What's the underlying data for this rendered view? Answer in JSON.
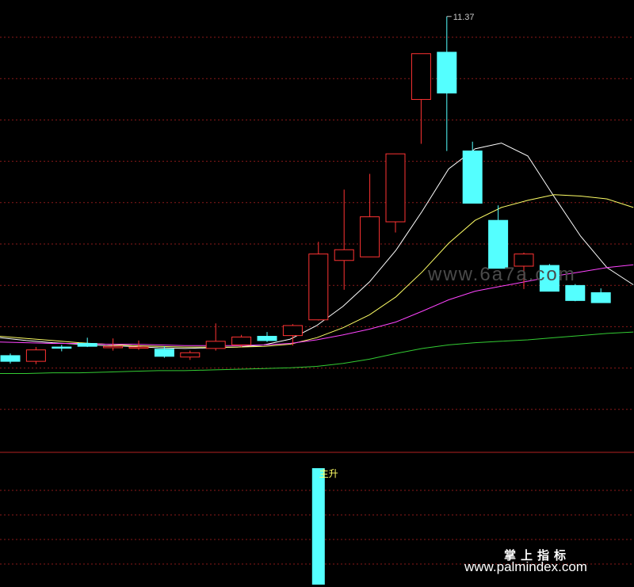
{
  "colors": {
    "background": "#000000",
    "grid": "#8b1a1a",
    "divider": "#b22222",
    "up": "#ff3333",
    "down": "#54ffff",
    "ma_white": "#ffffff",
    "ma_yellow": "#ffff66",
    "ma_magenta": "#ff44ff",
    "ma_green": "#33cc33",
    "label": "#c8c8c8",
    "signal": "#54ffff"
  },
  "chart_data": [
    {
      "type": "candlestick",
      "price_label": "11.37",
      "ylim": [
        5.4,
        11.6
      ],
      "candles": [
        {
          "o": 6.63,
          "h": 6.66,
          "l": 6.52,
          "c": 6.55
        },
        {
          "o": 6.55,
          "h": 6.75,
          "l": 6.51,
          "c": 6.71
        },
        {
          "o": 6.75,
          "h": 6.78,
          "l": 6.69,
          "c": 6.74
        },
        {
          "o": 6.8,
          "h": 6.88,
          "l": 6.75,
          "c": 6.76
        },
        {
          "o": 6.74,
          "h": 6.87,
          "l": 6.7,
          "c": 6.76
        },
        {
          "o": 6.75,
          "h": 6.84,
          "l": 6.71,
          "c": 6.75
        },
        {
          "o": 6.72,
          "h": 6.76,
          "l": 6.6,
          "c": 6.62
        },
        {
          "o": 6.61,
          "h": 6.7,
          "l": 6.57,
          "c": 6.67
        },
        {
          "o": 6.73,
          "h": 7.08,
          "l": 6.7,
          "c": 6.83
        },
        {
          "o": 6.78,
          "h": 6.92,
          "l": 6.75,
          "c": 6.89
        },
        {
          "o": 6.9,
          "h": 6.96,
          "l": 6.82,
          "c": 6.84
        },
        {
          "o": 6.91,
          "h": 7.07,
          "l": 6.77,
          "c": 7.05
        },
        {
          "o": 7.13,
          "h": 8.22,
          "l": 7.12,
          "c": 8.05
        },
        {
          "o": 7.96,
          "h": 8.95,
          "l": 7.55,
          "c": 8.11
        },
        {
          "o": 8.01,
          "h": 9.17,
          "l": 8.01,
          "c": 8.57
        },
        {
          "o": 8.5,
          "h": 9.31,
          "l": 8.35,
          "c": 9.45
        },
        {
          "o": 10.21,
          "h": 10.21,
          "l": 9.59,
          "c": 10.85
        },
        {
          "o": 10.87,
          "h": 11.37,
          "l": 9.49,
          "c": 10.3
        },
        {
          "o": 9.49,
          "h": 9.62,
          "l": 8.76,
          "c": 8.76
        },
        {
          "o": 8.52,
          "h": 8.73,
          "l": 7.85,
          "c": 7.85
        },
        {
          "o": 7.88,
          "h": 8.07,
          "l": 7.56,
          "c": 8.05
        },
        {
          "o": 7.89,
          "h": 7.91,
          "l": 7.53,
          "c": 7.53
        },
        {
          "o": 7.61,
          "h": 7.63,
          "l": 7.39,
          "c": 7.4
        },
        {
          "o": 7.51,
          "h": 7.57,
          "l": 7.37,
          "c": 7.37
        }
      ],
      "ma_series": [
        {
          "color_key": "ma_white",
          "values": [
            6.88,
            6.84,
            6.81,
            6.79,
            6.77,
            6.76,
            6.74,
            6.73,
            6.74,
            6.75,
            6.78,
            6.86,
            7.05,
            7.32,
            7.66,
            8.1,
            8.65,
            9.24,
            9.52,
            9.6,
            9.42,
            8.85,
            8.3,
            7.86,
            7.62
          ]
        },
        {
          "color_key": "ma_yellow",
          "values": [
            6.9,
            6.87,
            6.84,
            6.81,
            6.79,
            6.77,
            6.76,
            6.75,
            6.75,
            6.75,
            6.76,
            6.79,
            6.88,
            7.02,
            7.2,
            7.45,
            7.8,
            8.2,
            8.52,
            8.7,
            8.8,
            8.88,
            8.86,
            8.82,
            8.7
          ]
        },
        {
          "color_key": "ma_magenta",
          "values": [
            6.82,
            6.81,
            6.8,
            6.8,
            6.79,
            6.79,
            6.78,
            6.77,
            6.77,
            6.77,
            6.78,
            6.8,
            6.85,
            6.92,
            7.0,
            7.1,
            7.25,
            7.41,
            7.53,
            7.6,
            7.67,
            7.74,
            7.8,
            7.86,
            7.9
          ]
        },
        {
          "color_key": "ma_green",
          "values": [
            6.38,
            6.38,
            6.39,
            6.39,
            6.4,
            6.41,
            6.42,
            6.42,
            6.43,
            6.44,
            6.45,
            6.46,
            6.48,
            6.52,
            6.58,
            6.66,
            6.73,
            6.78,
            6.81,
            6.83,
            6.85,
            6.88,
            6.91,
            6.94,
            6.96
          ]
        }
      ],
      "grid": true
    },
    {
      "type": "bar",
      "series_label": "主升",
      "ylim": [
        0,
        1
      ],
      "values": [
        0,
        0,
        0,
        0,
        0,
        0,
        0,
        0,
        0,
        0,
        0,
        0,
        1,
        0,
        0,
        0,
        0,
        0,
        0,
        0,
        0,
        0,
        0,
        0,
        0
      ]
    }
  ],
  "watermarks": {
    "center": "www.6a7a.com",
    "brand_cn": "掌上指标",
    "brand_url": "www.palmindex.com"
  }
}
